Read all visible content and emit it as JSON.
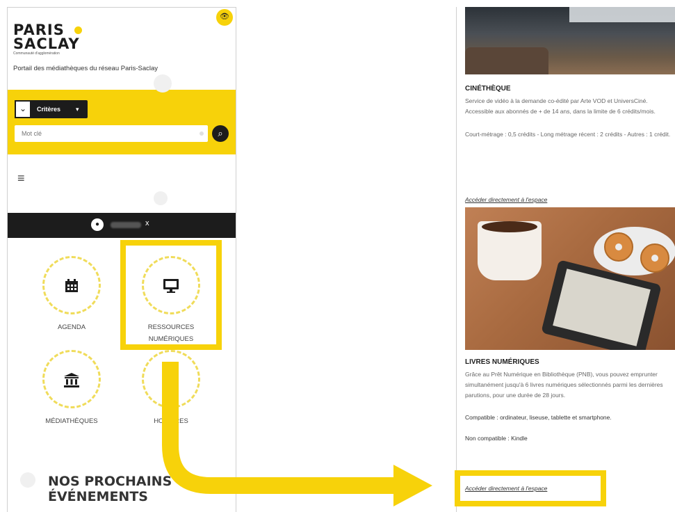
{
  "left_screen": {
    "logo": {
      "line1": "PARIS",
      "line2": "SACLAY",
      "subtitle": "Communauté d'agglomération"
    },
    "tagline": "Portail des médiathèques du réseau Paris-Saclay",
    "search": {
      "criteria_label": "Critères",
      "placeholder": "Mot clé"
    },
    "tiles": [
      {
        "label": "AGENDA",
        "icon": "calendar-icon"
      },
      {
        "label": "RESSOURCES NUMÉRIQUES",
        "icon": "monitor-icon"
      },
      {
        "label": "MÉDIATHÈQUES",
        "icon": "museum-icon"
      },
      {
        "label": "HORAIRES",
        "icon": "clock-icon"
      }
    ],
    "events_title_1": "NOS PROCHAINS",
    "events_title_2": "ÉVÉNEMENTS",
    "user_close": "x"
  },
  "right_screen": {
    "cine": {
      "title": "CINÉTHÈQUE",
      "desc1": "Service de vidéo à la demande co-édité par Arte VOD et UniversCiné. Accessible aux abonnés de + de 14 ans, dans la limite de 6 crédits/mois.",
      "desc2": "Court-métrage : 0,5 crédits - Long métrage récent : 2 crédits - Autres : 1 crédit.",
      "link": "Accéder directement à l'espace"
    },
    "livres": {
      "title": "LIVRES NUMÉRIQUES",
      "desc1": "Grâce au Prêt Numérique en Bibliothèque (PNB), vous pouvez emprunter simultanément jusqu'à 6 livres numériques sélectionnés parmi les dernières parutions, pour une durée de 28 jours.",
      "compat": "Compatible : ordinateur, liseuse, tablette et smartphone.",
      "noncompat": "Non compatible : Kindle",
      "link": "Accéder directement à l'espace"
    }
  },
  "colors": {
    "accent": "#f7d20a",
    "dark": "#1c1c1c"
  }
}
